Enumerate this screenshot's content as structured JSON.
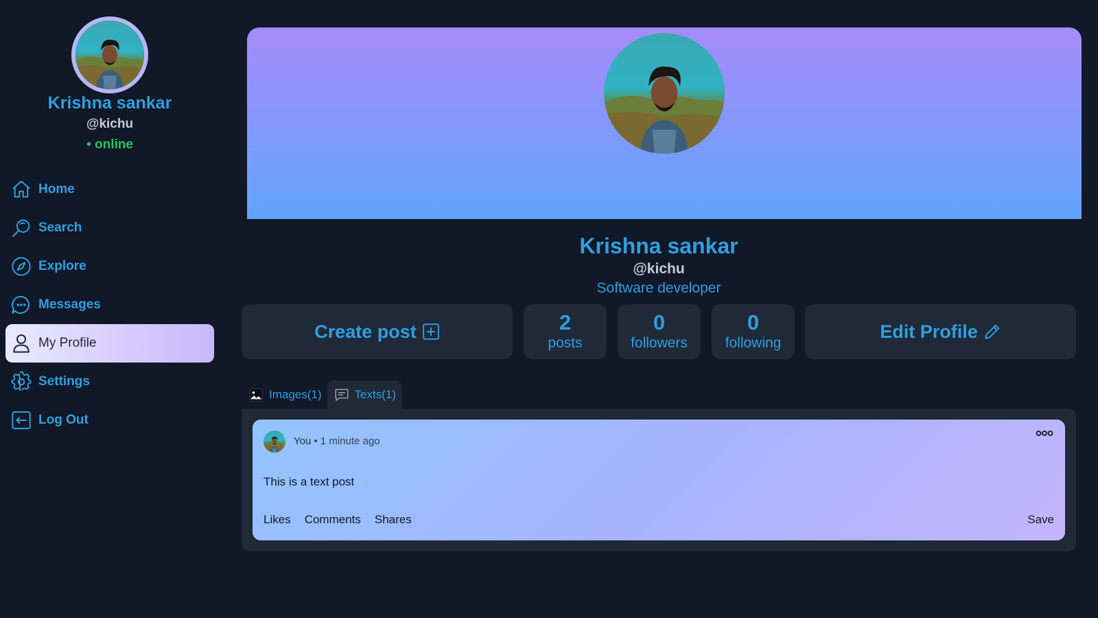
{
  "sidebar": {
    "user": {
      "name": "Krishna sankar",
      "handle": "@kichu",
      "status": "• online"
    },
    "items": [
      {
        "label": "Home",
        "icon": "home-icon"
      },
      {
        "label": "Search",
        "icon": "search-icon"
      },
      {
        "label": "Explore",
        "icon": "compass-icon"
      },
      {
        "label": "Messages",
        "icon": "chat-bubble-icon"
      },
      {
        "label": "My Profile",
        "icon": "user-icon",
        "active": true
      },
      {
        "label": "Settings",
        "icon": "gear-icon"
      },
      {
        "label": "Log Out",
        "icon": "logout-icon"
      }
    ]
  },
  "profile": {
    "name": "Krishna sankar",
    "handle": "@kichu",
    "bio": "Software developer"
  },
  "actions": {
    "create_post": "Create post",
    "edit_profile": "Edit Profile"
  },
  "stats": [
    {
      "value": "2",
      "label": "posts"
    },
    {
      "value": "0",
      "label": "followers"
    },
    {
      "value": "0",
      "label": "following"
    }
  ],
  "tabs": [
    {
      "label": "Images(1)",
      "icon": "image-icon"
    },
    {
      "label": "Texts(1)",
      "icon": "message-square-icon",
      "active": true
    }
  ],
  "post": {
    "author": "You",
    "time": "• 1 minute ago",
    "body": "This is a text post",
    "likes_label": "Likes",
    "comments_label": "Comments",
    "shares_label": "Shares",
    "save_label": "Save"
  },
  "colors": {
    "background": "#111827",
    "card": "#1f2937",
    "accent": "#2f9fe0",
    "online": "#22c55e",
    "banner_top": "#a78bfa",
    "banner_bottom": "#60a5fa"
  }
}
